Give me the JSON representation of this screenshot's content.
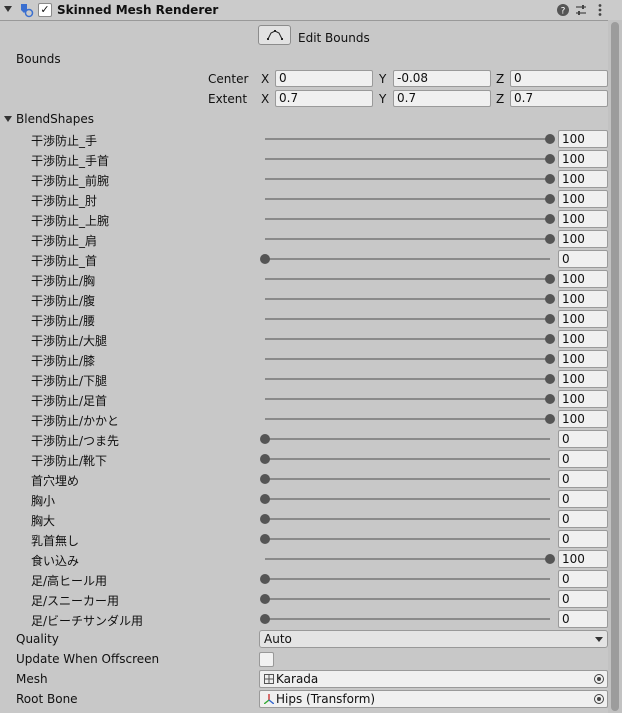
{
  "header": {
    "title": "Skinned Mesh Renderer",
    "enabled": true
  },
  "edit_bounds_label": "Edit Bounds",
  "bounds": {
    "label": "Bounds",
    "center": {
      "label": "Center",
      "x": "0",
      "y": "-0.08",
      "z": "0"
    },
    "extent": {
      "label": "Extent",
      "x": "0.7",
      "y": "0.7",
      "z": "0.7"
    },
    "axis_x": "X",
    "axis_y": "Y",
    "axis_z": "Z"
  },
  "blendshapes_label": "BlendShapes",
  "blendshapes": [
    {
      "name": "干渉防止_手",
      "value": "100"
    },
    {
      "name": "干渉防止_手首",
      "value": "100"
    },
    {
      "name": "干渉防止_前腕",
      "value": "100"
    },
    {
      "name": "干渉防止_肘",
      "value": "100"
    },
    {
      "name": "干渉防止_上腕",
      "value": "100"
    },
    {
      "name": "干渉防止_肩",
      "value": "100"
    },
    {
      "name": "干渉防止_首",
      "value": "0"
    },
    {
      "name": "干渉防止/胸",
      "value": "100"
    },
    {
      "name": "干渉防止/腹",
      "value": "100"
    },
    {
      "name": "干渉防止/腰",
      "value": "100"
    },
    {
      "name": "干渉防止/大腿",
      "value": "100"
    },
    {
      "name": "干渉防止/膝",
      "value": "100"
    },
    {
      "name": "干渉防止/下腿",
      "value": "100"
    },
    {
      "name": "干渉防止/足首",
      "value": "100"
    },
    {
      "name": "干渉防止/かかと",
      "value": "100"
    },
    {
      "name": "干渉防止/つま先",
      "value": "0"
    },
    {
      "name": "干渉防止/靴下",
      "value": "0"
    },
    {
      "name": "首穴埋め",
      "value": "0"
    },
    {
      "name": "胸小",
      "value": "0"
    },
    {
      "name": "胸大",
      "value": "0"
    },
    {
      "name": "乳首無し",
      "value": "0"
    },
    {
      "name": "食い込み",
      "value": "100"
    },
    {
      "name": "足/高ヒール用",
      "value": "0"
    },
    {
      "name": "足/スニーカー用",
      "value": "0"
    },
    {
      "name": "足/ビーチサンダル用",
      "value": "0"
    }
  ],
  "quality": {
    "label": "Quality",
    "value": "Auto"
  },
  "update_offscreen": {
    "label": "Update When Offscreen",
    "checked": false
  },
  "mesh": {
    "label": "Mesh",
    "value": "Karada"
  },
  "root_bone": {
    "label": "Root Bone",
    "value": "Hips (Transform)"
  },
  "icons": [
    "component-icon",
    "help-icon",
    "preset-icon",
    "more-icon",
    "edit-bounds-icon",
    "mesh-icon",
    "transform-icon",
    "object-picker-icon"
  ]
}
